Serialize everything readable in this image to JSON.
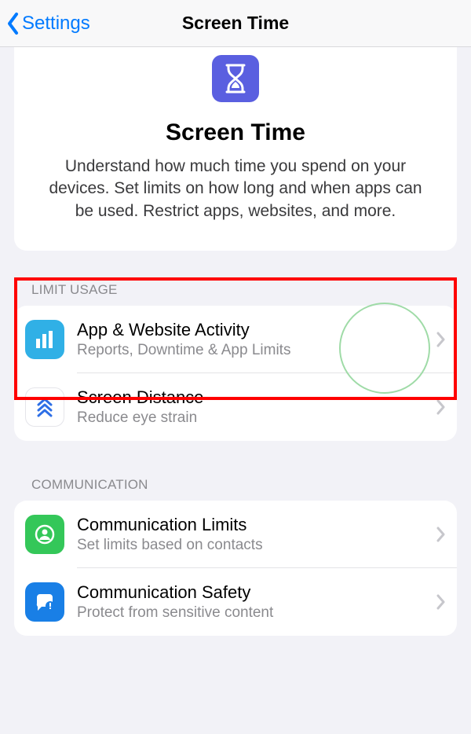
{
  "nav": {
    "back_label": "Settings",
    "title": "Screen Time"
  },
  "hero": {
    "title": "Screen Time",
    "description": "Understand how much time you spend on your devices. Set limits on how long and when apps can be used. Restrict apps, websites, and more."
  },
  "sections": {
    "limit_usage": {
      "header": "LIMIT USAGE",
      "items": [
        {
          "title": "App & Website Activity",
          "subtitle": "Reports, Downtime & App Limits"
        },
        {
          "title": "Screen Distance",
          "subtitle": "Reduce eye strain"
        }
      ]
    },
    "communication": {
      "header": "COMMUNICATION",
      "items": [
        {
          "title": "Communication Limits",
          "subtitle": "Set limits based on contacts"
        },
        {
          "title": "Communication Safety",
          "subtitle": "Protect from sensitive content"
        }
      ]
    }
  }
}
